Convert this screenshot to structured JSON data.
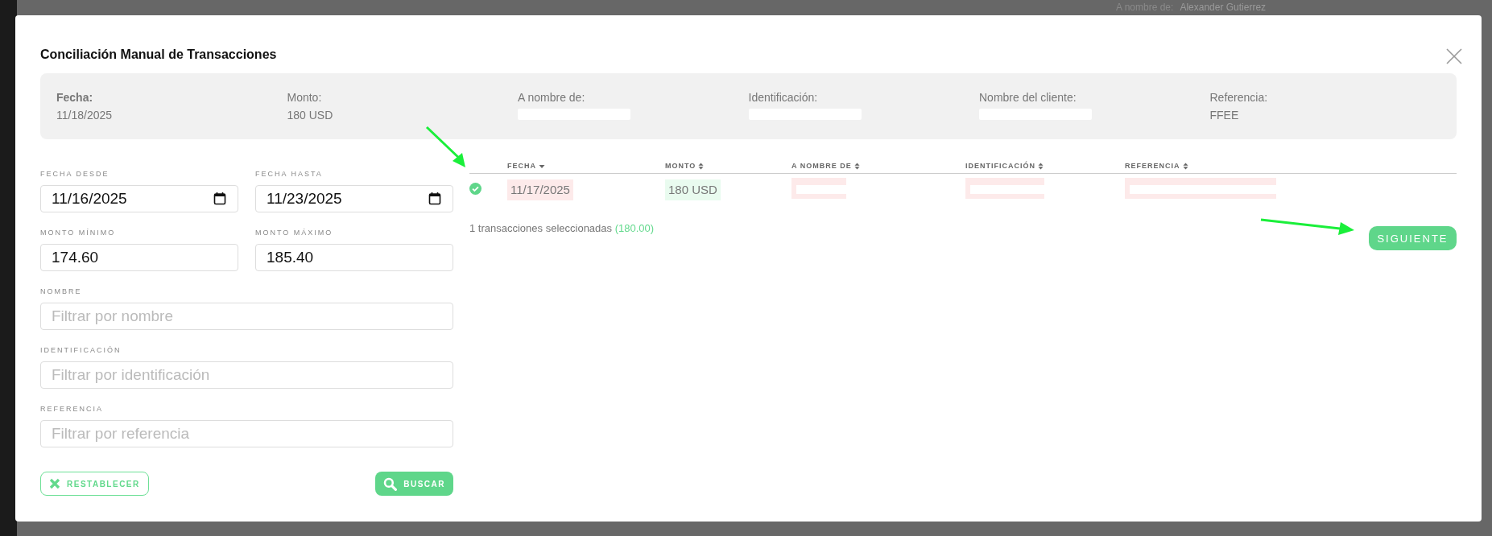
{
  "background_page": {
    "label": "A nombre de:",
    "value": "Alexander Gutierrez"
  },
  "dialog": {
    "title": "Conciliación Manual de Transacciones",
    "summary": [
      {
        "label": "Fecha:",
        "emphasis": true,
        "value": "11/18/2025",
        "redacted": false
      },
      {
        "label": "Monto:",
        "emphasis": false,
        "value": "180 USD",
        "redacted": false
      },
      {
        "label": "A nombre de:",
        "emphasis": false,
        "redacted": true
      },
      {
        "label": "Identificación:",
        "emphasis": false,
        "redacted": true
      },
      {
        "label": "Nombre del cliente:",
        "emphasis": false,
        "redacted": true
      },
      {
        "label": "Referencia:",
        "emphasis": false,
        "value": "FFEE",
        "redacted": false
      }
    ],
    "filters": [
      {
        "kind": "date",
        "label": "FECHA DESDE",
        "value": "11/16/2025",
        "half": true
      },
      {
        "kind": "date",
        "label": "FECHA HASTA",
        "value": "11/23/2025",
        "half": true
      },
      {
        "kind": "text",
        "label": "MONTO MÍNIMO",
        "value": "174.60",
        "half": true
      },
      {
        "kind": "text",
        "label": "MONTO MÁXIMO",
        "value": "185.40",
        "half": true
      },
      {
        "kind": "text",
        "label": "NOMBRE",
        "placeholder": "Filtrar por nombre",
        "half": false
      },
      {
        "kind": "text",
        "label": "IDENTIFICACIÓN",
        "placeholder": "Filtrar por identificación",
        "half": false
      },
      {
        "kind": "text",
        "label": "REFERENCIA",
        "placeholder": "Filtrar por referencia",
        "half": false
      }
    ],
    "reset_button": "RESTABLECER",
    "search_button": "BUSCAR",
    "table": {
      "columns": [
        {
          "label": "FECHA",
          "sorted": true
        },
        {
          "label": "MONTO",
          "sorted": false
        },
        {
          "label": "A NOMBRE DE",
          "sorted": false
        },
        {
          "label": "IDENTIFICACIÓN",
          "sorted": false
        },
        {
          "label": "REFERENCIA",
          "sorted": false
        }
      ],
      "rows": [
        {
          "selected": true,
          "cells": [
            {
              "value": "11/17/2025",
              "redacted": false,
              "color": "#fdeaea"
            },
            {
              "value": "180 USD",
              "redacted": false,
              "color": "#e9fbef"
            },
            {
              "redacted": true,
              "color": "#fdeaea"
            },
            {
              "redacted": true,
              "color": "#fdeaea"
            },
            {
              "redacted": true,
              "color": "#fdeaea"
            }
          ]
        }
      ]
    },
    "selection_summary": {
      "text": "1 transacciones seleccionadas",
      "amount": "(180.00)"
    },
    "next_button": "SIGUIENTE"
  }
}
